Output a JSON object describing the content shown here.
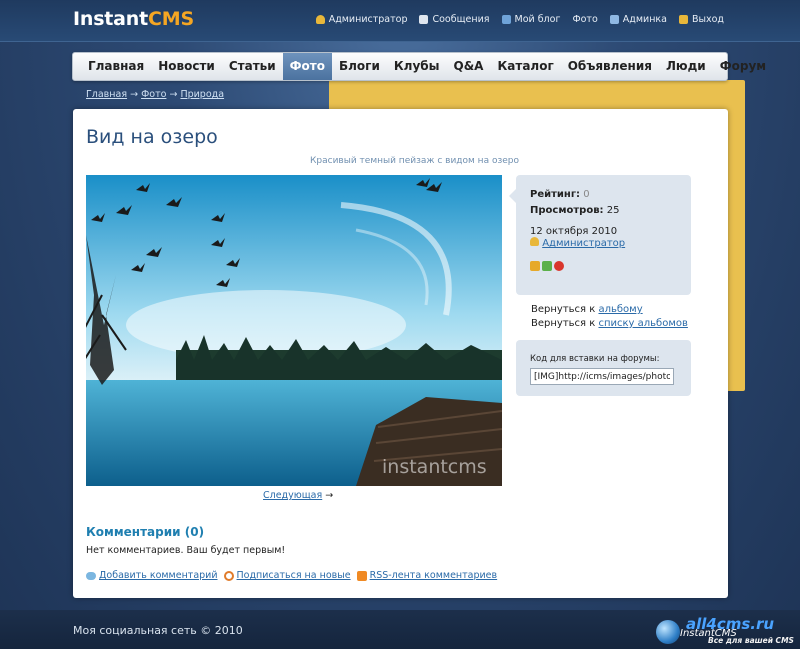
{
  "header": {
    "logo_part1": "Instant",
    "logo_part2": "CMS",
    "user_menu": [
      {
        "label": "Администратор",
        "icon": "user-icon"
      },
      {
        "label": "Сообщения",
        "icon": "mail-icon"
      },
      {
        "label": "Мой блог",
        "icon": "blog-icon"
      },
      {
        "label": "Фото",
        "icon": "photo-icon"
      },
      {
        "label": "Админка",
        "icon": "admin-panel-icon"
      },
      {
        "label": "Выход",
        "icon": "exit-icon"
      }
    ]
  },
  "nav": {
    "items": [
      "Главная",
      "Новости",
      "Статьи",
      "Фото",
      "Блоги",
      "Клубы",
      "Q&A",
      "Каталог",
      "Объявления",
      "Люди",
      "Форум"
    ],
    "active": "Фото"
  },
  "breadcrumb": {
    "items": [
      "Главная",
      "Фото",
      "Природа"
    ],
    "separator": "→"
  },
  "photo_page": {
    "title": "Вид на озеро",
    "caption": "Красивый темный пейзаж с видом на озеро",
    "watermark": "instantcms",
    "next_label": "Следующая",
    "next_arrow": "→"
  },
  "info": {
    "rating_label": "Рейтинг:",
    "rating_value": "0",
    "views_label": "Просмотров:",
    "views_value": "25",
    "date": "12 октября 2010",
    "author": "Администратор",
    "back_prefix": "Вернуться к",
    "back_album_link": "альбому",
    "back_list_link": "списку альбомов"
  },
  "embed": {
    "label": "Код для вставки на форумы:",
    "value": "[IMG]http://icms/images/photos"
  },
  "comments": {
    "title": "Комментарии (0)",
    "empty_text": "Нет комментариев. Ваш будет первым!",
    "add_link": "Добавить комментарий",
    "subscribe_link": "Подписаться на новые",
    "rss_link": "RSS-лента комментариев"
  },
  "footer": {
    "copyright": "Моя социальная сеть © 2010",
    "watermark_site": "all4cms.ru",
    "watermark_tagline": "Все для вашей CMS",
    "watermark_mark": "InstantCMS"
  },
  "colors": {
    "accent": "#2a4f7c",
    "nav_active": "#5a80ad",
    "comments_title": "#1f7fb0"
  }
}
